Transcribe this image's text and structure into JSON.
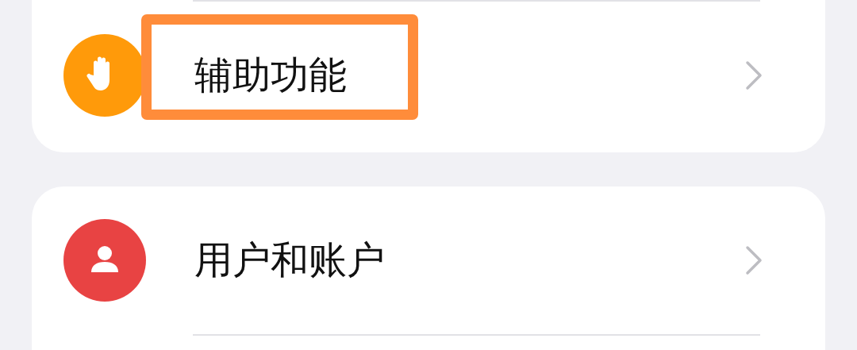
{
  "items": [
    {
      "label": "辅助功能",
      "kind": "hand",
      "color": "#ff9a0a",
      "highlighted": true
    },
    {
      "label": "用户和账户",
      "kind": "person",
      "color": "#e84343",
      "highlighted": false
    }
  ]
}
